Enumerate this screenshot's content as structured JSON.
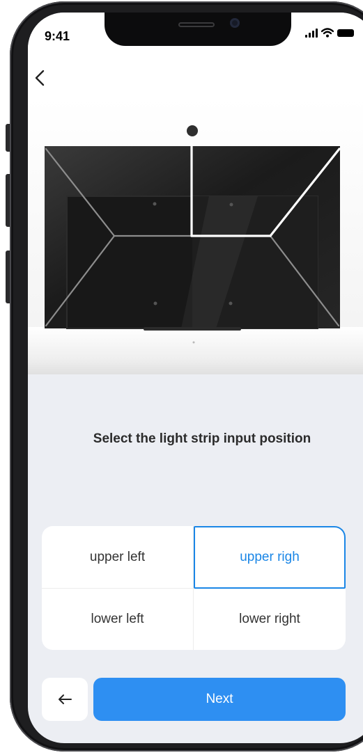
{
  "status_bar": {
    "time": "9:41",
    "icons": [
      "signal-icon",
      "wifi-icon",
      "battery-icon"
    ]
  },
  "header": {
    "back_icon": "chevron-left-icon"
  },
  "preview": {
    "description_icon": "tv-light-strip-diagram"
  },
  "prompt": {
    "title": "Select the light strip input position"
  },
  "options": {
    "items": [
      {
        "label": "upper left",
        "selected": false
      },
      {
        "label": "upper righ",
        "selected": true
      },
      {
        "label": "lower left",
        "selected": false
      },
      {
        "label": "lower right",
        "selected": false
      }
    ]
  },
  "footer": {
    "back_icon": "arrow-left-icon",
    "next_label": "Next"
  },
  "colors": {
    "accent": "#1a86e6",
    "primary_button": "#2e8ff2",
    "screen_background": "#eceef3"
  }
}
